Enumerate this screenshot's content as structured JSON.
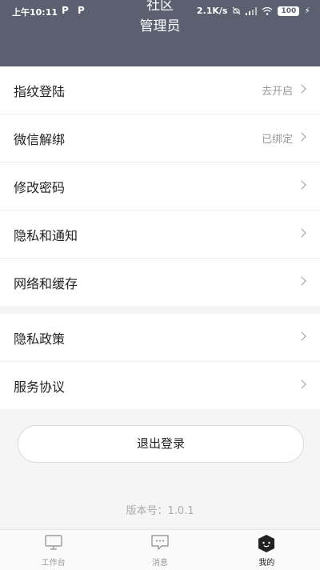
{
  "status_bar": {
    "time": "上午10:11",
    "app_icon_1": "P",
    "app_icon_2": "P",
    "network_speed": "2.1K/s",
    "battery": "100"
  },
  "header": {
    "partial_name": "社区",
    "title": "管理员"
  },
  "settings_group_1": [
    {
      "label": "指纹登陆",
      "value": "去开启"
    },
    {
      "label": "微信解绑",
      "value": "已绑定"
    },
    {
      "label": "修改密码",
      "value": ""
    },
    {
      "label": "隐私和通知",
      "value": ""
    },
    {
      "label": "网络和缓存",
      "value": ""
    }
  ],
  "settings_group_2": [
    {
      "label": "隐私政策"
    },
    {
      "label": "服务协议"
    }
  ],
  "logout_label": "退出登录",
  "version_text": "版本号：1.0.1",
  "bottom_nav": [
    {
      "label": "工作台",
      "icon": "monitor-icon"
    },
    {
      "label": "消息",
      "icon": "message-icon"
    },
    {
      "label": "我的",
      "icon": "profile-icon"
    }
  ],
  "colors": {
    "header_bg": "#5b6070",
    "page_bg": "#f5f5f5"
  }
}
